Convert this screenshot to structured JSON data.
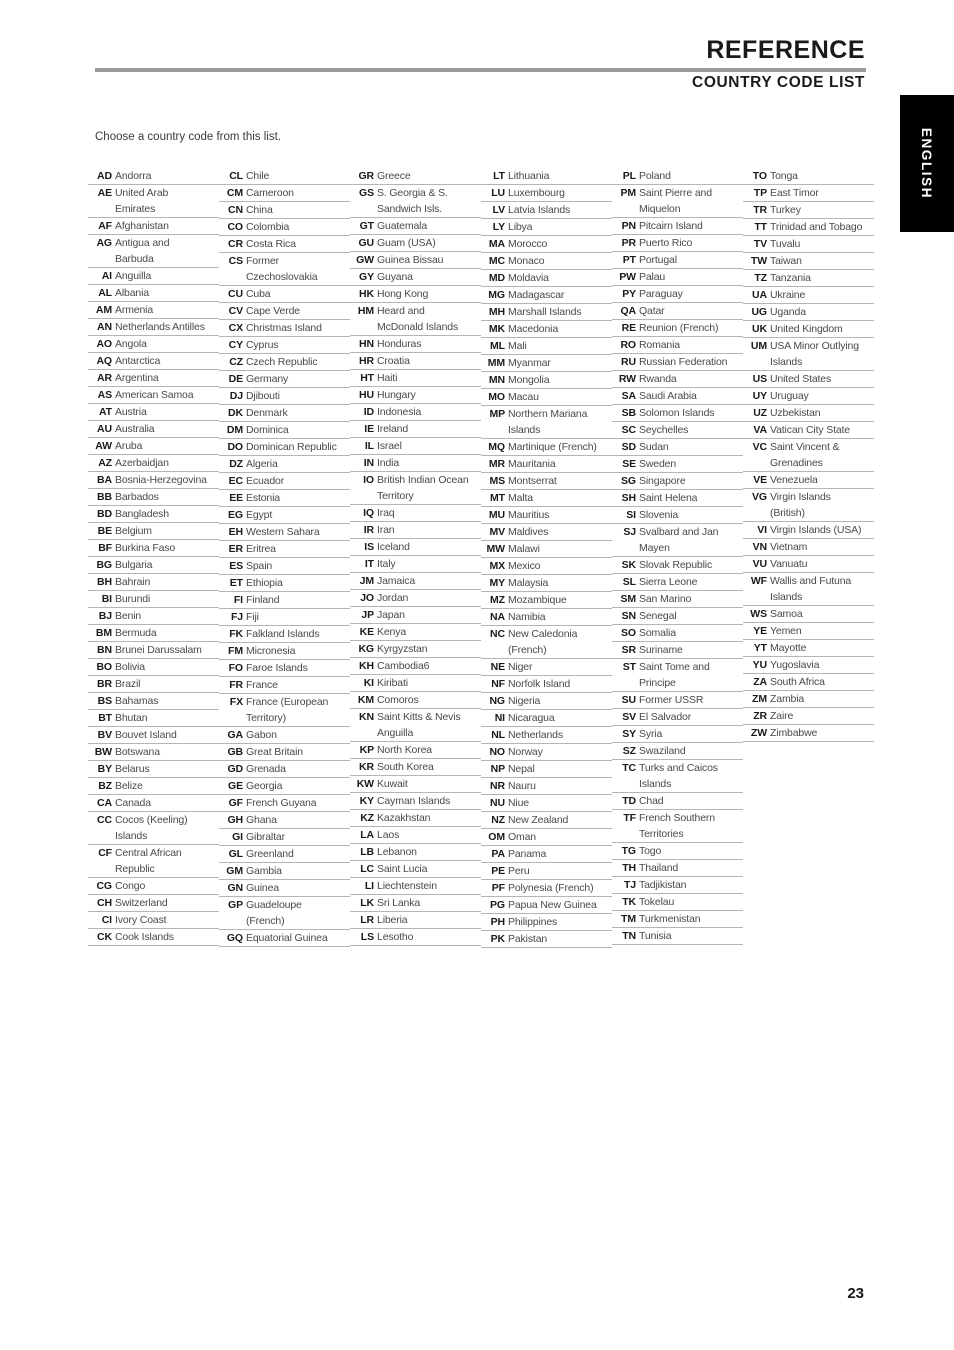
{
  "header": {
    "title": "REFERENCE",
    "subtitle": "COUNTRY CODE LIST"
  },
  "language_tab": {
    "label": "ENGLISH"
  },
  "intro": {
    "text": "Choose a country code from this list."
  },
  "footer": {
    "page_number": "23"
  },
  "columns": [
    {
      "entries": [
        {
          "code": "AD",
          "name": "Andorra"
        },
        {
          "code": "AE",
          "name": "United Arab",
          "name2": "Emirates"
        },
        {
          "code": "AF",
          "name": "Afghanistan"
        },
        {
          "code": "AG",
          "name": "Antigua and",
          "name2": "Barbuda"
        },
        {
          "code": "AI",
          "name": "Anguilla"
        },
        {
          "code": "AL",
          "name": "Albania"
        },
        {
          "code": "AM",
          "name": "Armenia"
        },
        {
          "code": "AN",
          "name": "Netherlands Antilles"
        },
        {
          "code": "AO",
          "name": "Angola"
        },
        {
          "code": "AQ",
          "name": "Antarctica"
        },
        {
          "code": "AR",
          "name": "Argentina"
        },
        {
          "code": "AS",
          "name": "American Samoa"
        },
        {
          "code": "AT",
          "name": "Austria"
        },
        {
          "code": "AU",
          "name": "Australia"
        },
        {
          "code": "AW",
          "name": "Aruba"
        },
        {
          "code": "AZ",
          "name": "Azerbaidjan"
        },
        {
          "code": "BA",
          "name": "Bosnia-Herzegovina"
        },
        {
          "code": "BB",
          "name": "Barbados"
        },
        {
          "code": "BD",
          "name": "Bangladesh"
        },
        {
          "code": "BE",
          "name": "Belgium"
        },
        {
          "code": "BF",
          "name": "Burkina Faso"
        },
        {
          "code": "BG",
          "name": "Bulgaria"
        },
        {
          "code": "BH",
          "name": "Bahrain"
        },
        {
          "code": "BI",
          "name": "Burundi"
        },
        {
          "code": "BJ",
          "name": "Benin"
        },
        {
          "code": "BM",
          "name": "Bermuda"
        },
        {
          "code": "BN",
          "name": "Brunei Darussalam"
        },
        {
          "code": "BO",
          "name": "Bolivia"
        },
        {
          "code": "BR",
          "name": "Brazil"
        },
        {
          "code": "BS",
          "name": "Bahamas"
        },
        {
          "code": "BT",
          "name": "Bhutan"
        },
        {
          "code": "BV",
          "name": "Bouvet Island"
        },
        {
          "code": "BW",
          "name": "Botswana"
        },
        {
          "code": "BY",
          "name": "Belarus"
        },
        {
          "code": "BZ",
          "name": "Belize"
        },
        {
          "code": "CA",
          "name": "Canada"
        },
        {
          "code": "CC",
          "name": "Cocos (Keeling)",
          "name2": "Islands"
        },
        {
          "code": "CF",
          "name": "Central African",
          "name2": "Republic"
        },
        {
          "code": "CG",
          "name": "Congo"
        },
        {
          "code": "CH",
          "name": "Switzerland"
        },
        {
          "code": "CI",
          "name": "Ivory Coast"
        },
        {
          "code": "CK",
          "name": "Cook Islands"
        }
      ]
    },
    {
      "entries": [
        {
          "code": "CL",
          "name": "Chile"
        },
        {
          "code": "CM",
          "name": "Cameroon"
        },
        {
          "code": "CN",
          "name": "China"
        },
        {
          "code": "CO",
          "name": "Colombia"
        },
        {
          "code": "CR",
          "name": "Costa Rica"
        },
        {
          "code": "CS",
          "name": "Former",
          "name2": "Czechoslovakia"
        },
        {
          "code": "CU",
          "name": "Cuba"
        },
        {
          "code": "CV",
          "name": "Cape Verde"
        },
        {
          "code": "CX",
          "name": "Christmas Island"
        },
        {
          "code": "CY",
          "name": "Cyprus"
        },
        {
          "code": "CZ",
          "name": "Czech Republic"
        },
        {
          "code": "DE",
          "name": "Germany"
        },
        {
          "code": "DJ",
          "name": "Djibouti"
        },
        {
          "code": "DK",
          "name": "Denmark"
        },
        {
          "code": "DM",
          "name": "Dominica"
        },
        {
          "code": "DO",
          "name": "Dominican Republic"
        },
        {
          "code": "DZ",
          "name": "Algeria"
        },
        {
          "code": "EC",
          "name": "Ecuador"
        },
        {
          "code": "EE",
          "name": "Estonia"
        },
        {
          "code": "EG",
          "name": "Egypt"
        },
        {
          "code": "EH",
          "name": "Western Sahara"
        },
        {
          "code": "ER",
          "name": "Eritrea"
        },
        {
          "code": "ES",
          "name": "Spain"
        },
        {
          "code": "ET",
          "name": "Ethiopia"
        },
        {
          "code": "FI",
          "name": "Finland"
        },
        {
          "code": "FJ",
          "name": "Fiji"
        },
        {
          "code": "FK",
          "name": "Falkland Islands"
        },
        {
          "code": "FM",
          "name": "Micronesia"
        },
        {
          "code": "FO",
          "name": "Faroe Islands"
        },
        {
          "code": "FR",
          "name": "France"
        },
        {
          "code": "FX",
          "name": "France (European",
          "name2": "Territory)"
        },
        {
          "code": "GA",
          "name": "Gabon"
        },
        {
          "code": "GB",
          "name": "Great Britain"
        },
        {
          "code": "GD",
          "name": "Grenada"
        },
        {
          "code": "GE",
          "name": "Georgia"
        },
        {
          "code": "GF",
          "name": "French Guyana"
        },
        {
          "code": "GH",
          "name": "Ghana"
        },
        {
          "code": "GI",
          "name": "Gibraltar"
        },
        {
          "code": "GL",
          "name": "Greenland"
        },
        {
          "code": "GM",
          "name": "Gambia"
        },
        {
          "code": "GN",
          "name": "Guinea"
        },
        {
          "code": "GP",
          "name": "Guadeloupe",
          "name2": "(French)"
        },
        {
          "code": "GQ",
          "name": "Equatorial Guinea"
        }
      ]
    },
    {
      "entries": [
        {
          "code": "GR",
          "name": "Greece"
        },
        {
          "code": "GS",
          "name": "S. Georgia & S.",
          "name2": "Sandwich Isls."
        },
        {
          "code": "GT",
          "name": "Guatemala"
        },
        {
          "code": "GU",
          "name": "Guam (USA)"
        },
        {
          "code": "GW",
          "name": "Guinea Bissau"
        },
        {
          "code": "GY",
          "name": "Guyana"
        },
        {
          "code": "HK",
          "name": "Hong Kong"
        },
        {
          "code": "HM",
          "name": "Heard and",
          "name2": "McDonald Islands"
        },
        {
          "code": "HN",
          "name": "Honduras"
        },
        {
          "code": "HR",
          "name": "Croatia"
        },
        {
          "code": "HT",
          "name": "Haiti"
        },
        {
          "code": "HU",
          "name": "Hungary"
        },
        {
          "code": "ID",
          "name": "Indonesia"
        },
        {
          "code": "IE",
          "name": "Ireland"
        },
        {
          "code": "IL",
          "name": "Israel"
        },
        {
          "code": "IN",
          "name": "India"
        },
        {
          "code": "IO",
          "name": "British Indian Ocean",
          "name2": "Territory"
        },
        {
          "code": "IQ",
          "name": "Iraq"
        },
        {
          "code": "IR",
          "name": "Iran"
        },
        {
          "code": "IS",
          "name": "Iceland"
        },
        {
          "code": "IT",
          "name": "Italy"
        },
        {
          "code": "JM",
          "name": "Jamaica"
        },
        {
          "code": "JO",
          "name": "Jordan"
        },
        {
          "code": "JP",
          "name": "Japan"
        },
        {
          "code": "KE",
          "name": "Kenya"
        },
        {
          "code": "KG",
          "name": "Kyrgyzstan"
        },
        {
          "code": "KH",
          "name": "Cambodia6"
        },
        {
          "code": "KI",
          "name": "Kiribati"
        },
        {
          "code": "KM",
          "name": "Comoros"
        },
        {
          "code": "KN",
          "name": "Saint Kitts & Nevis",
          "name2": "Anguilla"
        },
        {
          "code": "KP",
          "name": "North Korea"
        },
        {
          "code": "KR",
          "name": "South Korea"
        },
        {
          "code": "KW",
          "name": "Kuwait"
        },
        {
          "code": "KY",
          "name": "Cayman Islands"
        },
        {
          "code": "KZ",
          "name": "Kazakhstan"
        },
        {
          "code": "LA",
          "name": "Laos"
        },
        {
          "code": "LB",
          "name": "Lebanon"
        },
        {
          "code": "LC",
          "name": "Saint Lucia"
        },
        {
          "code": "LI",
          "name": "Liechtenstein"
        },
        {
          "code": "LK",
          "name": "Sri Lanka"
        },
        {
          "code": "LR",
          "name": "Liberia"
        },
        {
          "code": "LS",
          "name": "Lesotho"
        }
      ]
    },
    {
      "entries": [
        {
          "code": "LT",
          "name": "Lithuania"
        },
        {
          "code": "LU",
          "name": "Luxembourg"
        },
        {
          "code": "LV",
          "name": "Latvia Islands"
        },
        {
          "code": "LY",
          "name": "Libya"
        },
        {
          "code": "MA",
          "name": "Morocco"
        },
        {
          "code": "MC",
          "name": "Monaco"
        },
        {
          "code": "MD",
          "name": "Moldavia"
        },
        {
          "code": "MG",
          "name": "Madagascar"
        },
        {
          "code": "MH",
          "name": "Marshall Islands"
        },
        {
          "code": "MK",
          "name": "Macedonia"
        },
        {
          "code": "ML",
          "name": "Mali"
        },
        {
          "code": "MM",
          "name": "Myanmar"
        },
        {
          "code": "MN",
          "name": "Mongolia"
        },
        {
          "code": "MO",
          "name": "Macau"
        },
        {
          "code": "MP",
          "name": "Northern Mariana",
          "name2": "Islands"
        },
        {
          "code": "MQ",
          "name": "Martinique (French)"
        },
        {
          "code": "MR",
          "name": "Mauritania"
        },
        {
          "code": "MS",
          "name": "Montserrat"
        },
        {
          "code": "MT",
          "name": "Malta"
        },
        {
          "code": "MU",
          "name": "Mauritius"
        },
        {
          "code": "MV",
          "name": "Maldives"
        },
        {
          "code": "MW",
          "name": "Malawi"
        },
        {
          "code": "MX",
          "name": "Mexico"
        },
        {
          "code": "MY",
          "name": "Malaysia"
        },
        {
          "code": "MZ",
          "name": "Mozambique"
        },
        {
          "code": "NA",
          "name": "Namibia"
        },
        {
          "code": "NC",
          "name": "New Caledonia",
          "name2": "(French)"
        },
        {
          "code": "NE",
          "name": "Niger"
        },
        {
          "code": "NF",
          "name": "Norfolk Island"
        },
        {
          "code": "NG",
          "name": "Nigeria"
        },
        {
          "code": "NI",
          "name": "Nicaragua"
        },
        {
          "code": "NL",
          "name": "Netherlands"
        },
        {
          "code": "NO",
          "name": "Norway"
        },
        {
          "code": "NP",
          "name": "Nepal"
        },
        {
          "code": "NR",
          "name": "Nauru"
        },
        {
          "code": "NU",
          "name": "Niue"
        },
        {
          "code": "NZ",
          "name": "New Zealand"
        },
        {
          "code": "OM",
          "name": "Oman"
        },
        {
          "code": "PA",
          "name": "Panama"
        },
        {
          "code": "PE",
          "name": "Peru"
        },
        {
          "code": "PF",
          "name": "Polynesia (French)"
        },
        {
          "code": "PG",
          "name": "Papua New Guinea"
        },
        {
          "code": "PH",
          "name": "Philippines"
        },
        {
          "code": "PK",
          "name": "Pakistan"
        }
      ]
    },
    {
      "entries": [
        {
          "code": "PL",
          "name": "Poland"
        },
        {
          "code": "PM",
          "name": "Saint Pierre and",
          "name2": "Miquelon"
        },
        {
          "code": "PN",
          "name": "Pitcairn Island"
        },
        {
          "code": "PR",
          "name": "Puerto Rico"
        },
        {
          "code": "PT",
          "name": "Portugal"
        },
        {
          "code": "PW",
          "name": "Palau"
        },
        {
          "code": "PY",
          "name": "Paraguay"
        },
        {
          "code": "QA",
          "name": "Qatar"
        },
        {
          "code": "RE",
          "name": "Reunion (French)"
        },
        {
          "code": "RO",
          "name": "Romania"
        },
        {
          "code": "RU",
          "name": "Russian Federation"
        },
        {
          "code": "RW",
          "name": "Rwanda"
        },
        {
          "code": "SA",
          "name": "Saudi Arabia"
        },
        {
          "code": "SB",
          "name": "Solomon Islands"
        },
        {
          "code": "SC",
          "name": "Seychelles"
        },
        {
          "code": "SD",
          "name": "Sudan"
        },
        {
          "code": "SE",
          "name": "Sweden"
        },
        {
          "code": "SG",
          "name": "Singapore"
        },
        {
          "code": "SH",
          "name": "Saint Helena"
        },
        {
          "code": "SI",
          "name": "Slovenia"
        },
        {
          "code": "SJ",
          "name": "Svalbard and  Jan",
          "name2": "Mayen"
        },
        {
          "code": "SK",
          "name": "Slovak Republic"
        },
        {
          "code": "SL",
          "name": "Sierra Leone"
        },
        {
          "code": "SM",
          "name": "San Marino"
        },
        {
          "code": "SN",
          "name": "Senegal"
        },
        {
          "code": "SO",
          "name": "Somalia"
        },
        {
          "code": "SR",
          "name": "Suriname"
        },
        {
          "code": "ST",
          "name": "Saint Tome and",
          "name2": "Principe"
        },
        {
          "code": "SU",
          "name": "Former USSR"
        },
        {
          "code": "SV",
          "name": "El Salvador"
        },
        {
          "code": "SY",
          "name": "Syria"
        },
        {
          "code": "SZ",
          "name": "Swaziland"
        },
        {
          "code": "TC",
          "name": "Turks and Caicos",
          "name2": "Islands"
        },
        {
          "code": "TD",
          "name": "Chad"
        },
        {
          "code": "TF",
          "name": "French Southern",
          "name2": "Territories"
        },
        {
          "code": "TG",
          "name": "Togo"
        },
        {
          "code": "TH",
          "name": "Thailand"
        },
        {
          "code": "TJ",
          "name": "Tadjikistan"
        },
        {
          "code": "TK",
          "name": "Tokelau"
        },
        {
          "code": "TM",
          "name": "Turkmenistan"
        },
        {
          "code": "TN",
          "name": "Tunisia"
        }
      ]
    },
    {
      "entries": [
        {
          "code": "TO",
          "name": "Tonga"
        },
        {
          "code": "TP",
          "name": "East Timor"
        },
        {
          "code": "TR",
          "name": "Turkey"
        },
        {
          "code": "TT",
          "name": "Trinidad and Tobago"
        },
        {
          "code": "TV",
          "name": "Tuvalu"
        },
        {
          "code": "TW",
          "name": "Taiwan"
        },
        {
          "code": "TZ",
          "name": "Tanzania"
        },
        {
          "code": "UA",
          "name": "Ukraine"
        },
        {
          "code": "UG",
          "name": "Uganda"
        },
        {
          "code": "UK",
          "name": "United Kingdom"
        },
        {
          "code": "UM",
          "name": "USA Minor Outlying",
          "name2": "Islands"
        },
        {
          "code": "US",
          "name": "United States"
        },
        {
          "code": "UY",
          "name": "Uruguay"
        },
        {
          "code": "UZ",
          "name": "Uzbekistan"
        },
        {
          "code": "VA",
          "name": "Vatican City State"
        },
        {
          "code": "VC",
          "name": "Saint Vincent &",
          "name2": "Grenadines"
        },
        {
          "code": "VE",
          "name": "Venezuela"
        },
        {
          "code": "VG",
          "name": "Virgin Islands",
          "name2": "(British)"
        },
        {
          "code": "VI",
          "name": "Virgin Islands (USA)"
        },
        {
          "code": "VN",
          "name": "Vietnam"
        },
        {
          "code": "VU",
          "name": "Vanuatu"
        },
        {
          "code": "WF",
          "name": "Wallis and Futuna",
          "name2": "Islands"
        },
        {
          "code": "WS",
          "name": "Samoa"
        },
        {
          "code": "YE",
          "name": "Yemen"
        },
        {
          "code": "YT",
          "name": "Mayotte"
        },
        {
          "code": "YU",
          "name": "Yugoslavia"
        },
        {
          "code": "ZA",
          "name": "South Africa"
        },
        {
          "code": "ZM",
          "name": "Zambia"
        },
        {
          "code": "ZR",
          "name": "Zaire"
        },
        {
          "code": "ZW",
          "name": "Zimbabwe"
        }
      ]
    }
  ]
}
